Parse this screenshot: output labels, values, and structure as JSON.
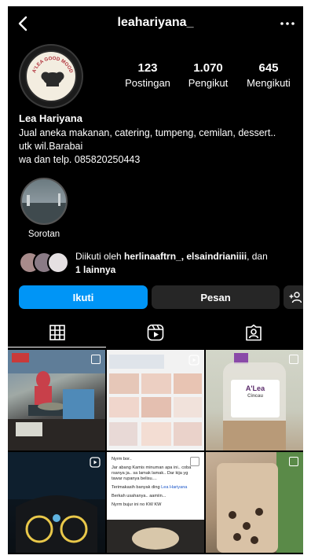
{
  "header": {
    "username": "leahariyana_",
    "back_icon": "chevron-left-icon",
    "more_icon": "more-horizontal-icon"
  },
  "avatar": {
    "logo_text": "A'LEA GOOD MOOD"
  },
  "stats": [
    {
      "value": "123",
      "label": "Postingan"
    },
    {
      "value": "1.070",
      "label": "Pengikut"
    },
    {
      "value": "645",
      "label": "Mengikuti"
    }
  ],
  "bio": {
    "name": "Lea Hariyana",
    "line1": "Jual aneka makanan, catering, tumpeng, cemilan, dessert..",
    "line2": "utk wil.Barabai",
    "line3": "wa dan telp. 085820250443"
  },
  "highlight": {
    "label": "Sorotan"
  },
  "followed_by": {
    "prefix": "Diikuti oleh ",
    "names": "herlinaaftrn_, elsaindrianiiii",
    "connector": ", dan ",
    "rest": "1 lainnya"
  },
  "buttons": {
    "follow": "Ikuti",
    "message": "Pesan",
    "add_user_icon": "add-user-icon"
  },
  "tabs": [
    {
      "icon": "grid-icon"
    },
    {
      "icon": "reels-icon"
    },
    {
      "icon": "tagged-icon"
    }
  ],
  "posts": {
    "p3_label": "A'Lea",
    "p3_sub": "Cincau",
    "p5_lines": [
      "Nyrm bor..",
      "Jar abang Kamis minuman apa ini.. coba rsanya ja.. sa lamak lamak.. Dar kija yg tawar rupanya belisu....",
      "Terimakasih banyak ding",
      "Lea Hariyana",
      "Berkah usahanya.. aamiin...",
      "Nyrm bujur ini no KW KW"
    ]
  },
  "colors": {
    "background": "#000000",
    "follow_button": "#0095f6",
    "secondary_button": "#262626"
  }
}
